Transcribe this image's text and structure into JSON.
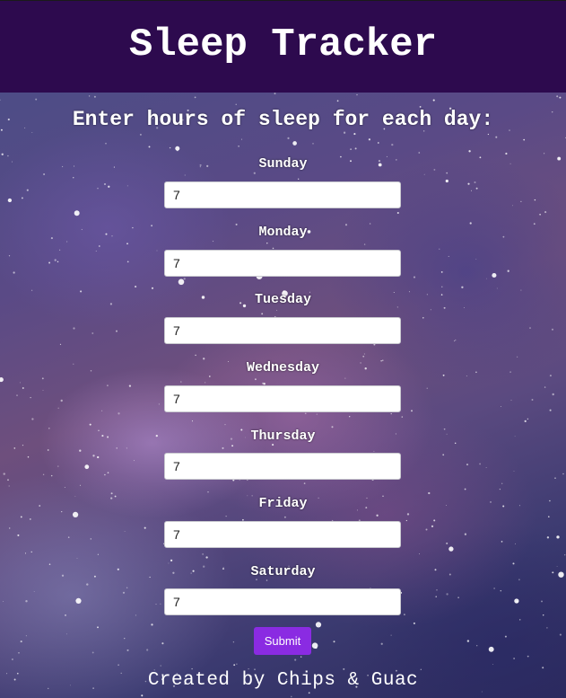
{
  "header": {
    "title": "Sleep Tracker"
  },
  "form": {
    "prompt": "Enter hours of sleep for each day:",
    "days": [
      {
        "label": "Sunday",
        "value": "7"
      },
      {
        "label": "Monday",
        "value": "7"
      },
      {
        "label": "Tuesday",
        "value": "7"
      },
      {
        "label": "Wednesday",
        "value": "7"
      },
      {
        "label": "Thursday",
        "value": "7"
      },
      {
        "label": "Friday",
        "value": "7"
      },
      {
        "label": "Saturday",
        "value": "7"
      }
    ],
    "submit_label": "Submit"
  },
  "footer": {
    "credit": "Created by Chips & Guac"
  },
  "colors": {
    "header_bg": "#2d0a4e",
    "submit_bg": "#8a2be2"
  }
}
